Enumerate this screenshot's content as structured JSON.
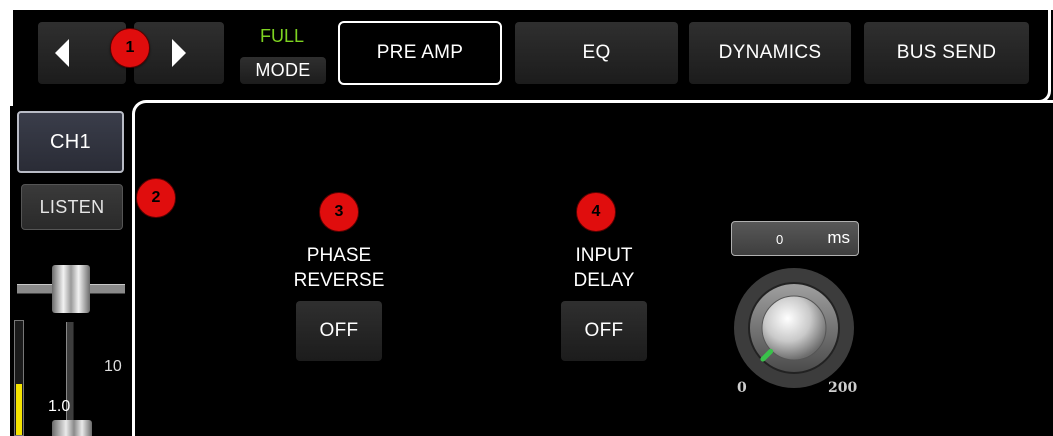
{
  "nav": {
    "prev_icon": "triangle-left-icon",
    "next_icon": "triangle-right-icon",
    "mode_status": "FULL",
    "mode_label": "MODE"
  },
  "tabs": [
    {
      "label": "PRE AMP",
      "selected": true
    },
    {
      "label": "EQ",
      "selected": false
    },
    {
      "label": "DYNAMICS",
      "selected": false
    },
    {
      "label": "BUS SEND",
      "selected": false
    }
  ],
  "channel": {
    "name": "CH1",
    "listen_label": "LISTEN",
    "fader_scale_top": "10",
    "fader_scale_value": "1.0",
    "meter_level": 0.45
  },
  "badges": {
    "b1": "1",
    "b2": "2",
    "b3": "3",
    "b4": "4"
  },
  "phase": {
    "label_line1": "PHASE",
    "label_line2": "REVERSE",
    "value": "OFF"
  },
  "input_delay": {
    "label_line1": "INPUT",
    "label_line2": "DELAY",
    "value": "OFF",
    "readout_value": "0",
    "readout_unit": "ms",
    "knob_min": "0",
    "knob_max": "200",
    "knob_fraction": 0.0
  },
  "colors": {
    "mode_green": "#7ed321",
    "badge_red": "#e00d0d",
    "meter_yellow": "#f5e400",
    "knob_indicator": "#39c24a"
  }
}
